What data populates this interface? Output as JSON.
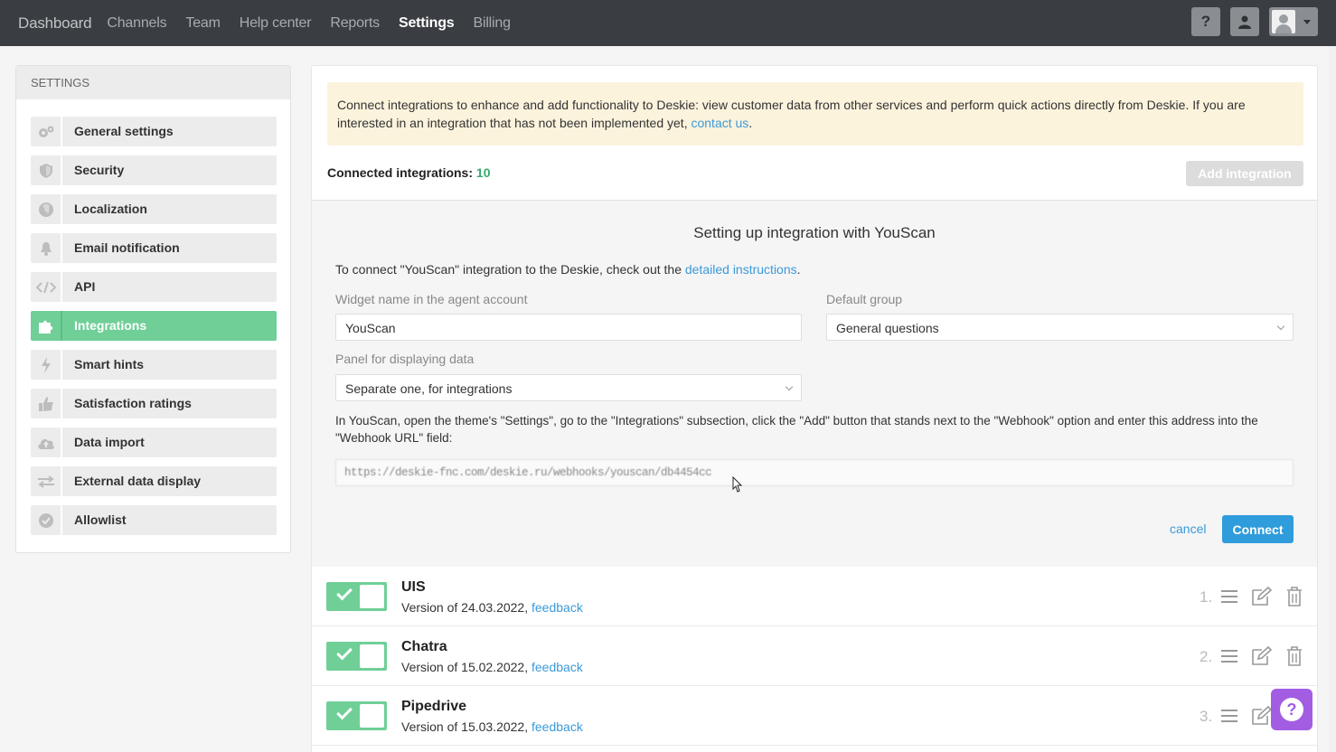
{
  "nav": {
    "items": [
      "Dashboard",
      "Channels",
      "Team",
      "Help center",
      "Reports",
      "Settings",
      "Billing"
    ],
    "active": "Settings",
    "help_label": "?"
  },
  "sidebar": {
    "header": "SETTINGS",
    "items": [
      {
        "label": "General settings",
        "icon": "gears-icon"
      },
      {
        "label": "Security",
        "icon": "shield-icon"
      },
      {
        "label": "Localization",
        "icon": "globe-icon"
      },
      {
        "label": "Email notification",
        "icon": "bell-icon"
      },
      {
        "label": "API",
        "icon": "code-icon"
      },
      {
        "label": "Integrations",
        "icon": "puzzle-icon"
      },
      {
        "label": "Smart hints",
        "icon": "lightning-icon"
      },
      {
        "label": "Satisfaction ratings",
        "icon": "thumbs-up-icon"
      },
      {
        "label": "Data import",
        "icon": "cloud-upload-icon"
      },
      {
        "label": "External data display",
        "icon": "arrows-icon"
      },
      {
        "label": "Allowlist",
        "icon": "check-badge-icon"
      }
    ],
    "active_index": 5
  },
  "notice": {
    "text": "Connect integrations to enhance and add functionality to Deskie: view customer data from other services and perform quick actions directly from Deskie. If you are interested in an integration that has not been implemented yet, ",
    "link": "contact us",
    "tail": "."
  },
  "connected": {
    "label": "Connected integrations:",
    "count": "10",
    "add_button": "Add integration"
  },
  "setup": {
    "title": "Setting up integration with YouScan",
    "desc_prefix": "To connect \"YouScan\" integration to the Deskie, check out the ",
    "desc_link": "detailed instructions",
    "desc_suffix": ".",
    "widget_label": "Widget name in the agent account",
    "widget_value": "YouScan",
    "group_label": "Default group",
    "group_value": "General questions",
    "panel_label": "Panel for displaying data",
    "panel_value": "Separate one, for integrations",
    "instructions": "In YouScan, open the theme's \"Settings\", go to the \"Integrations\" subsection, click the \"Add\" button that stands next to the \"Webhook\" option and enter this address into the \"Webhook URL\" field:",
    "webhook_url": "https://deskie-fnc.com/deskie.ru/webhooks/youscan/db4454cc",
    "cancel": "cancel",
    "connect": "Connect"
  },
  "integrations": [
    {
      "name": "UIS",
      "version": "Version of 24.03.2022,",
      "feedback": "feedback",
      "index": "1."
    },
    {
      "name": "Chatra",
      "version": "Version of 15.02.2022,",
      "feedback": "feedback",
      "index": "2."
    },
    {
      "name": "Pipedrive",
      "version": "Version of 15.03.2022,",
      "feedback": "feedback",
      "index": "3."
    }
  ],
  "colors": {
    "accent_green": "#6fcf97",
    "link_blue": "#3a9ad9",
    "connect_blue": "#2f9cdb",
    "topbar": "#3a3d42",
    "notice_bg": "#fcf3dd",
    "help_purple": "#a25de3"
  }
}
